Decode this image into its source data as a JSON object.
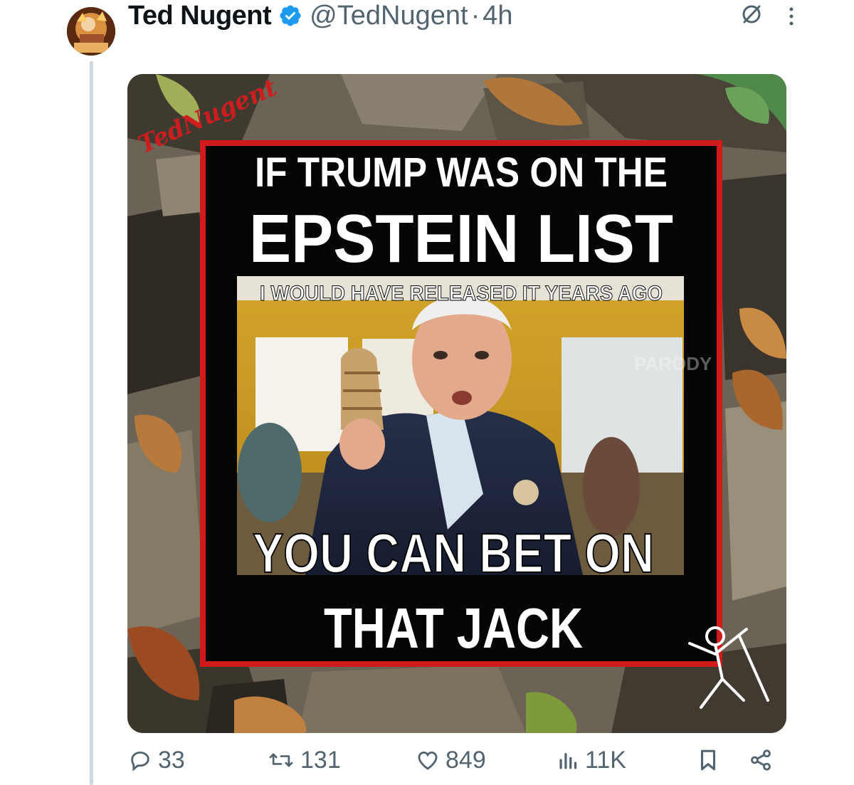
{
  "author": {
    "display_name": "Ted Nugent",
    "handle": "@TedNugent",
    "separator": "·",
    "timestamp": "4h",
    "verified": true
  },
  "media": {
    "logo_text": "TedNugent",
    "line1": "IF TRUMP WAS ON THE",
    "line2": "EPSTEIN LIST",
    "line3": "I WOULD HAVE RELEASED IT YEARS AGO",
    "line4": "YOU CAN BET ON",
    "line5": "THAT JACK",
    "photo_watermark": "PARODY"
  },
  "actions": {
    "replies": "33",
    "reposts": "131",
    "likes": "849",
    "views": "11K"
  },
  "icons": {
    "reply": "reply-icon",
    "repost": "repost-icon",
    "like": "heart-icon",
    "views": "views-icon",
    "bookmark": "bookmark-icon",
    "share": "share-icon",
    "grok": "grok-icon",
    "more": "more-icon",
    "verified": "verified-badge-icon"
  },
  "colors": {
    "text_primary": "#0f1419",
    "text_secondary": "#536471",
    "verified_blue": "#1d9bf0",
    "meme_border_red": "#d11a1a"
  }
}
